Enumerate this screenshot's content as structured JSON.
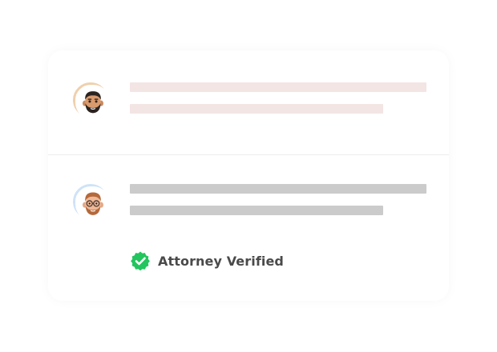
{
  "colors": {
    "placeholder_pink": "#f3e5e4",
    "placeholder_gray": "#cbcbcb",
    "avatar_ring_1": "#efd0ad",
    "avatar_ring_2": "#cfe3f7",
    "verified_green": "#23c55e",
    "label_text": "#4a4a4a"
  },
  "comments": [
    {
      "avatar_icon": "bearded-man-memoji-icon",
      "text_placeholder_lines": 2
    },
    {
      "avatar_icon": "glasses-man-memoji-icon",
      "text_placeholder_lines": 2,
      "badge": {
        "icon": "verified-check-badge-icon",
        "label": "Attorney Verified"
      }
    }
  ]
}
